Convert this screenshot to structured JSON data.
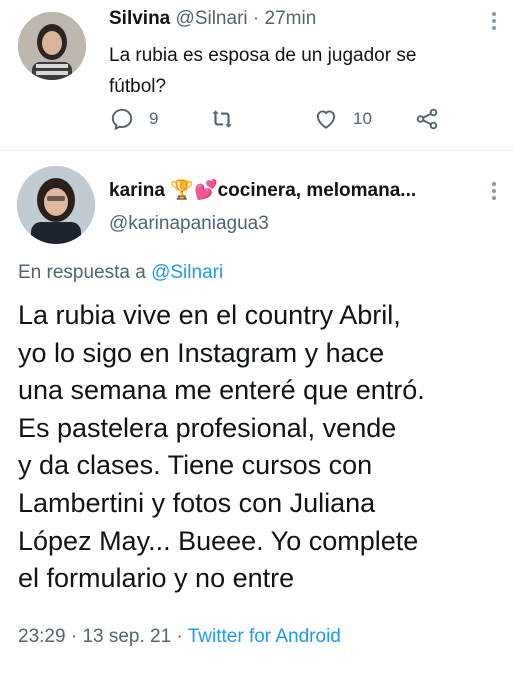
{
  "tweet1": {
    "author_name": "Silvina",
    "handle": "@Silnari",
    "separator": "·",
    "time": "27min",
    "text": "La rubia es esposa de un jugador se fútbol?",
    "actions": {
      "reply_icon": "reply-icon",
      "reply_count": "9",
      "retweet_icon": "retweet-icon",
      "like_icon": "heart-icon",
      "like_count": "10",
      "share_icon": "share-icon"
    }
  },
  "tweet2": {
    "author_name": "karina",
    "emoji_trophy": "🏆",
    "emoji_heart": "💕",
    "bio_excerpt": "cocinera, melomana...",
    "handle": "@karinapaniagua3",
    "reply_prefix": "En respuesta a",
    "reply_target": "@Silnari",
    "body_lines": [
      "La rubia vive en el country Abril,",
      "yo lo sigo en Instagram y hace",
      "una semana me enteré que entró.",
      "Es pastelera profesional, vende",
      "y da clases. Tiene cursos con",
      "Lambertini y fotos con Juliana",
      "López May... Bueee. Yo complete",
      "el formulario y no entre"
    ],
    "time": "23:29",
    "date": "13 sep. 21",
    "source": "Twitter for Android"
  },
  "colors": {
    "text": "#0f1419",
    "muted": "#536471",
    "link": "#1d9bf0",
    "divider": "#eff3f4"
  }
}
